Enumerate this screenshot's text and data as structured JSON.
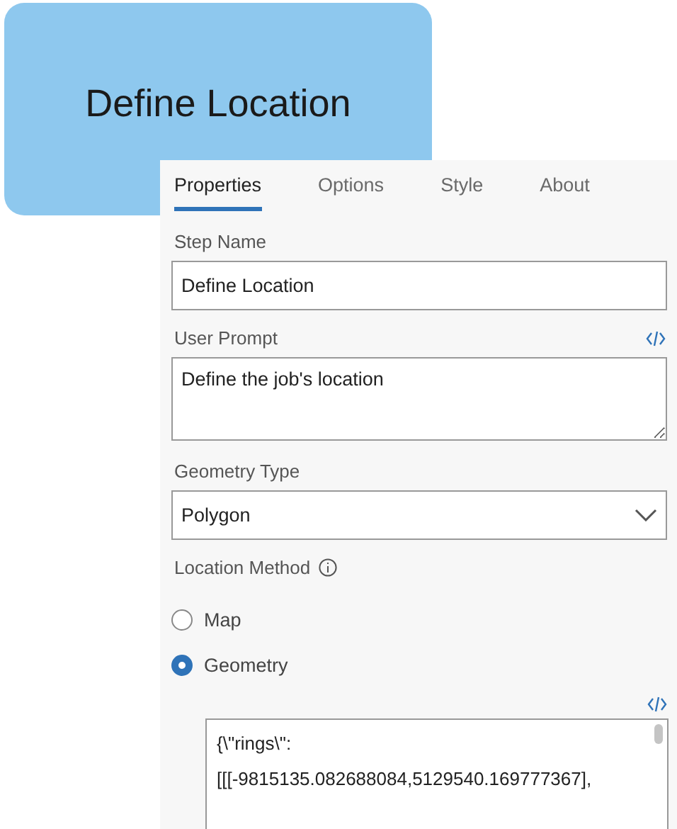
{
  "node": {
    "title": "Define Location"
  },
  "tabs": [
    {
      "label": "Properties",
      "selected": true
    },
    {
      "label": "Options",
      "selected": false
    },
    {
      "label": "Style",
      "selected": false
    },
    {
      "label": "About",
      "selected": false
    }
  ],
  "step_name": {
    "label": "Step Name",
    "value": "Define Location"
  },
  "user_prompt": {
    "label": "User Prompt",
    "value": "Define the job's location"
  },
  "geometry_type": {
    "label": "Geometry Type",
    "value": "Polygon"
  },
  "location_method": {
    "label": "Location Method",
    "options": [
      {
        "label": "Map",
        "selected": false
      },
      {
        "label": "Geometry",
        "selected": true
      }
    ]
  },
  "geometry": {
    "value": "{\\\"rings\\\": [[[-9815135.082688084,5129540.169777367],"
  }
}
